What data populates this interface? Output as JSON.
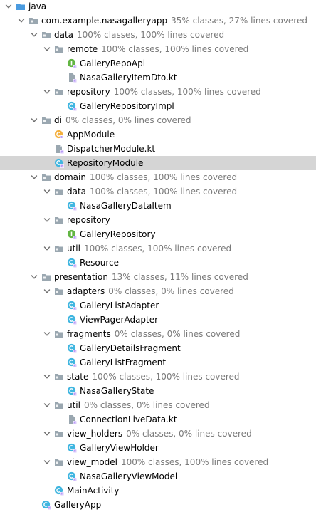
{
  "colors": {
    "selected_row_bg": "#d5d5d5",
    "coverage_text": "#7a7a7a",
    "folder_icon": "#9aa7b0",
    "class_icon": "#40b6e0",
    "interface_icon": "#62b543",
    "module_icon": "#f4af3d",
    "file_icon": "#9aa7b0",
    "badge_accent": "#b99bf8"
  },
  "nodes": [
    {
      "depth": 0,
      "arrow": "expanded",
      "icon": "folder-icon",
      "label": "java",
      "coverage": ""
    },
    {
      "depth": 1,
      "arrow": "expanded",
      "icon": "package-icon",
      "label": "com.example.nasagalleryapp",
      "coverage": "35% classes, 27% lines covered"
    },
    {
      "depth": 2,
      "arrow": "expanded",
      "icon": "package-icon",
      "label": "data",
      "coverage": "100% classes, 100% lines covered"
    },
    {
      "depth": 3,
      "arrow": "expanded",
      "icon": "package-icon",
      "label": "remote",
      "coverage": "100% classes, 100% lines covered"
    },
    {
      "depth": 4,
      "arrow": "none",
      "icon": "interface-icon",
      "label": "GalleryRepoApi",
      "coverage": ""
    },
    {
      "depth": 4,
      "arrow": "none",
      "icon": "kotlin-file-icon",
      "label": "NasaGalleryItemDto.kt",
      "coverage": ""
    },
    {
      "depth": 3,
      "arrow": "expanded",
      "icon": "package-icon",
      "label": "repository",
      "coverage": "100% classes, 100% lines covered"
    },
    {
      "depth": 4,
      "arrow": "none",
      "icon": "class-icon",
      "label": "GalleryRepositoryImpl",
      "coverage": ""
    },
    {
      "depth": 2,
      "arrow": "expanded",
      "icon": "package-icon",
      "label": "di",
      "coverage": "0% classes, 0% lines covered"
    },
    {
      "depth": 3,
      "arrow": "none",
      "icon": "module-icon",
      "label": "AppModule",
      "coverage": ""
    },
    {
      "depth": 3,
      "arrow": "none",
      "icon": "kotlin-file-icon",
      "label": "DispatcherModule.kt",
      "coverage": ""
    },
    {
      "depth": 3,
      "arrow": "none",
      "icon": "class-icon",
      "label": "RepositoryModule",
      "coverage": "",
      "selected": true
    },
    {
      "depth": 2,
      "arrow": "expanded",
      "icon": "package-icon",
      "label": "domain",
      "coverage": "100% classes, 100% lines covered"
    },
    {
      "depth": 3,
      "arrow": "expanded",
      "icon": "package-icon",
      "label": "data",
      "coverage": "100% classes, 100% lines covered"
    },
    {
      "depth": 4,
      "arrow": "none",
      "icon": "class-icon",
      "label": "NasaGalleryDataItem",
      "coverage": ""
    },
    {
      "depth": 3,
      "arrow": "expanded",
      "icon": "package-icon",
      "label": "repository",
      "coverage": ""
    },
    {
      "depth": 4,
      "arrow": "none",
      "icon": "interface-icon",
      "label": "GalleryRepository",
      "coverage": ""
    },
    {
      "depth": 3,
      "arrow": "expanded",
      "icon": "package-icon",
      "label": "util",
      "coverage": "100% classes, 100% lines covered"
    },
    {
      "depth": 4,
      "arrow": "none",
      "icon": "class-icon",
      "label": "Resource",
      "coverage": ""
    },
    {
      "depth": 2,
      "arrow": "expanded",
      "icon": "package-icon",
      "label": "presentation",
      "coverage": "13% classes, 11% lines covered"
    },
    {
      "depth": 3,
      "arrow": "expanded",
      "icon": "package-icon",
      "label": "adapters",
      "coverage": "0% classes, 0% lines covered"
    },
    {
      "depth": 4,
      "arrow": "none",
      "icon": "class-icon",
      "label": "GalleryListAdapter",
      "coverage": ""
    },
    {
      "depth": 4,
      "arrow": "none",
      "icon": "class-icon",
      "label": "ViewPagerAdapter",
      "coverage": ""
    },
    {
      "depth": 3,
      "arrow": "expanded",
      "icon": "package-icon",
      "label": "fragments",
      "coverage": "0% classes, 0% lines covered"
    },
    {
      "depth": 4,
      "arrow": "none",
      "icon": "class-icon",
      "label": "GalleryDetailsFragment",
      "coverage": ""
    },
    {
      "depth": 4,
      "arrow": "none",
      "icon": "class-icon",
      "label": "GalleryListFragment",
      "coverage": ""
    },
    {
      "depth": 3,
      "arrow": "expanded",
      "icon": "package-icon",
      "label": "state",
      "coverage": "100% classes, 100% lines covered"
    },
    {
      "depth": 4,
      "arrow": "none",
      "icon": "class-icon",
      "label": "NasaGalleryState",
      "coverage": ""
    },
    {
      "depth": 3,
      "arrow": "expanded",
      "icon": "package-icon",
      "label": "util",
      "coverage": "0% classes, 0% lines covered"
    },
    {
      "depth": 4,
      "arrow": "none",
      "icon": "kotlin-file-icon",
      "label": "ConnectionLiveData.kt",
      "coverage": ""
    },
    {
      "depth": 3,
      "arrow": "expanded",
      "icon": "package-icon",
      "label": "view_holders",
      "coverage": "0% classes, 0% lines covered"
    },
    {
      "depth": 4,
      "arrow": "none",
      "icon": "class-icon",
      "label": "GalleryViewHolder",
      "coverage": ""
    },
    {
      "depth": 3,
      "arrow": "expanded",
      "icon": "package-icon",
      "label": "view_model",
      "coverage": "100% classes, 100% lines covered"
    },
    {
      "depth": 4,
      "arrow": "none",
      "icon": "class-icon",
      "label": "NasaGalleryViewModel",
      "coverage": ""
    },
    {
      "depth": 3,
      "arrow": "none",
      "icon": "class-icon",
      "label": "MainActivity",
      "coverage": ""
    },
    {
      "depth": 2,
      "arrow": "none",
      "icon": "class-icon",
      "label": "GalleryApp",
      "coverage": ""
    }
  ]
}
